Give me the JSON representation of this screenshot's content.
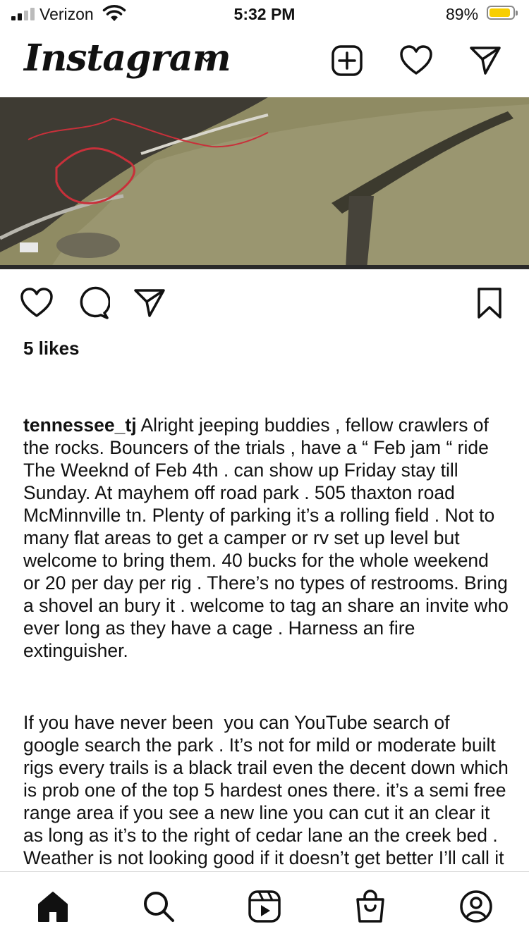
{
  "status_bar": {
    "carrier": "Verizon",
    "time": "5:32 PM",
    "battery_percent": "89%",
    "battery_level": 0.89
  },
  "header": {
    "logo": "Instagram",
    "icons": [
      "chevron-down-icon",
      "new-post-icon",
      "heart-icon",
      "direct-message-icon"
    ]
  },
  "post": {
    "likes": "5 likes",
    "username": "tennessee_tj",
    "caption_paragraph_1": " Alright jeeping buddies , fellow crawlers of the rocks. Bouncers of the trials , have a “ Feb jam “ ride The Weeknd of Feb 4th . can show up Friday stay till Sunday. At mayhem off road park . 505 thaxton road McMinnville tn. Plenty of parking it’s a rolling field . Not to many flat areas to get a camper or rv set up level but welcome to bring them. 40 bucks for the whole weekend or 20 per day per rig . There’s no types of restrooms. Bring a shovel an bury it . welcome to tag an share an invite who ever long as they have a cage . Harness an fire extinguisher.",
    "caption_paragraph_2": "If you have never been  you can YouTube search of google search the park . It’s not for mild or moderate built rigs every trails is a black trail even the decent down which is prob one of the top 5 hardest ones there. it’s a semi free range area if you see a new line you can cut it an clear it as long as it’s to the right of cedar lane an the creek bed . Weather is not looking good if it doesn’t get better I’ll call it off or go to aop . This place is retard when wet look forward to seeing some old friends an new ones . Thanks",
    "action_icons": [
      "heart-icon",
      "comment-icon",
      "share-icon",
      "bookmark-icon"
    ]
  },
  "bottom_nav": {
    "icons": [
      "home-icon",
      "search-icon",
      "reels-icon",
      "shop-icon",
      "profile-icon"
    ]
  }
}
